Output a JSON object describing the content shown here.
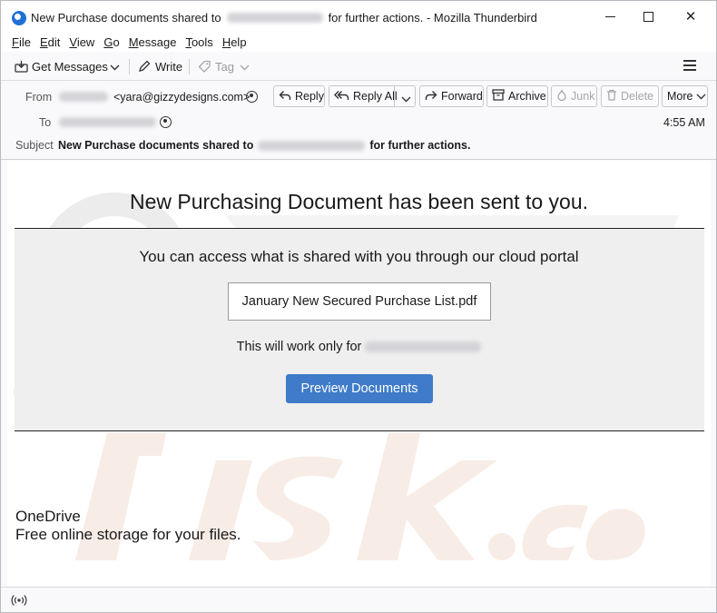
{
  "window": {
    "title_prefix": "New Purchase documents shared to",
    "title_suffix": "for further actions. - Mozilla Thunderbird",
    "minimize_icon": "minimize-icon",
    "maximize_icon": "maximize-icon",
    "close_glyph": "✕"
  },
  "menubar": {
    "items": [
      {
        "key": "F",
        "rest": "ile"
      },
      {
        "key": "E",
        "rest": "dit"
      },
      {
        "key": "V",
        "rest": "iew"
      },
      {
        "key": "G",
        "rest": "o"
      },
      {
        "key": "M",
        "rest": "essage"
      },
      {
        "key": "T",
        "rest": "ools"
      },
      {
        "key": "H",
        "rest": "elp"
      }
    ]
  },
  "toolbar": {
    "get_messages": "Get Messages",
    "write": "Write",
    "tag": "Tag"
  },
  "header": {
    "from_label": "From",
    "from_email": "<yara@gizzydesigns.com>",
    "to_label": "To",
    "subject_label": "Subject",
    "subject_prefix": "New Purchase documents shared to",
    "subject_suffix": "for further actions.",
    "time": "4:55 AM",
    "actions": {
      "reply": "Reply",
      "reply_all": "Reply All",
      "forward": "Forward",
      "archive": "Archive",
      "junk": "Junk",
      "delete": "Delete",
      "more": "More"
    }
  },
  "message": {
    "heading": "New Purchasing Document has been sent to you.",
    "access_text": "You can access what is shared with you through our cloud portal",
    "file_name": "January New Secured Purchase List.pdf",
    "work_text": "This will work only for",
    "button": "Preview Documents",
    "footer_title": "OneDrive",
    "footer_sub": "Free online storage for your files."
  },
  "colors": {
    "button_blue": "#3f7bc8",
    "grey_panel": "#efefef"
  }
}
